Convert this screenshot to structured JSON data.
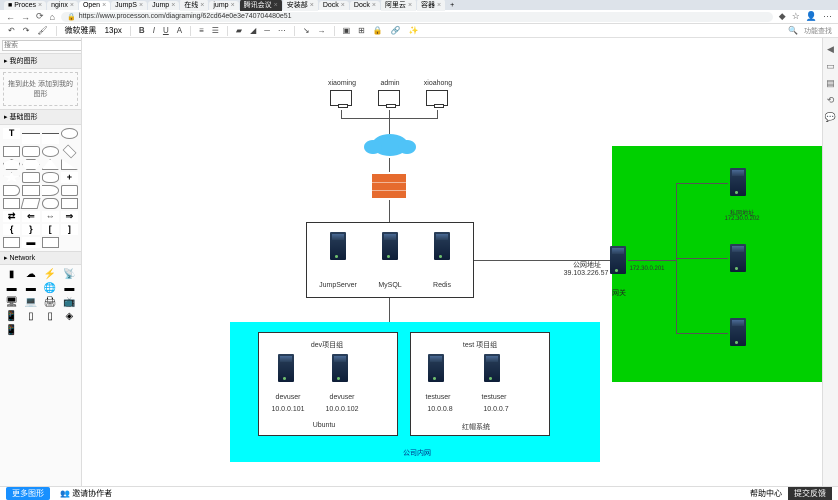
{
  "tabs": [
    {
      "label": "Proces",
      "icon": "■"
    },
    {
      "label": "nginx",
      "icon": "On"
    },
    {
      "label": "Open",
      "icon": "On",
      "active": true
    },
    {
      "label": "JumpS"
    },
    {
      "label": "Jump"
    },
    {
      "label": "在线"
    },
    {
      "label": "jump"
    },
    {
      "label": "腾讯会议"
    },
    {
      "label": "安装部"
    },
    {
      "label": "Dock"
    },
    {
      "label": "Dock"
    },
    {
      "label": "阿里云"
    },
    {
      "label": "容器"
    }
  ],
  "url": "https://www.processon.com/diagraming/62cd64e0e3e740704480e51",
  "toolbar": {
    "font": "微软雅黑",
    "size": "13px",
    "search_placeholder": "功能查找"
  },
  "sidebar": {
    "search": "搜索",
    "my": "我的图形",
    "drag": "拖到此处\n添加到我的图形",
    "basic": "基础图形",
    "network": "Network"
  },
  "diagram": {
    "users": [
      "xiaoming",
      "admin",
      "xioahong"
    ],
    "jump_box": {
      "labels": [
        "JumpServer",
        "MySQL",
        "Redis"
      ]
    },
    "pub_ip_label": "公网地址",
    "pub_ip": "39.103.226.57",
    "gw": "网关",
    "gw_ip": "172.30.0.201",
    "priv_label": "私网地址",
    "priv_ip": "172.30.0.202",
    "cyan_title": "公司内网",
    "dev": {
      "title": "dev项目组",
      "u1": "devuser",
      "ip1": "10.0.0.101",
      "u2": "devuser",
      "ip2": "10.0.0.102",
      "os": "Ubuntu"
    },
    "test": {
      "title": "test 项目组",
      "u1": "testuser",
      "ip1": "10.0.0.8",
      "u2": "testuser",
      "ip2": "10.0.0.7",
      "os": "红帽系统"
    }
  },
  "bottom": {
    "more": "更多图形",
    "invite": "邀请协作者",
    "help": "帮助中心",
    "feedback": "提交反馈"
  }
}
